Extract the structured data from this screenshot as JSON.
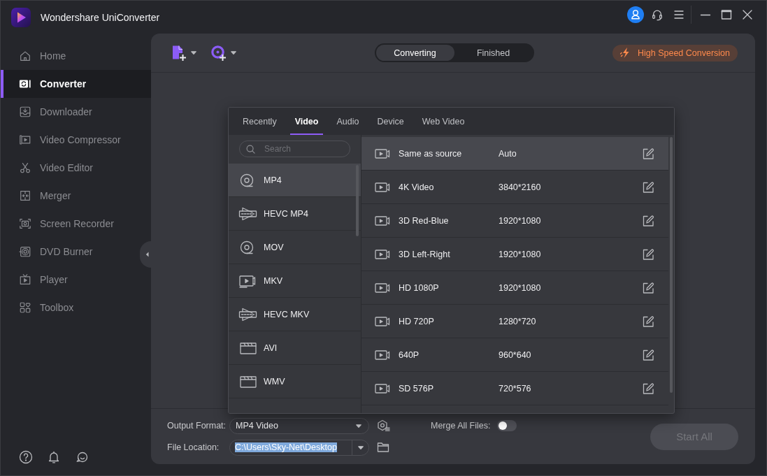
{
  "window": {
    "title": "Wondershare UniConverter"
  },
  "sidebar": {
    "items": [
      {
        "label": "Home",
        "selected": false
      },
      {
        "label": "Converter",
        "selected": true
      },
      {
        "label": "Downloader",
        "selected": false
      },
      {
        "label": "Video Compressor",
        "selected": false
      },
      {
        "label": "Video Editor",
        "selected": false
      },
      {
        "label": "Merger",
        "selected": false
      },
      {
        "label": "Screen Recorder",
        "selected": false
      },
      {
        "label": "DVD Burner",
        "selected": false
      },
      {
        "label": "Player",
        "selected": false
      },
      {
        "label": "Toolbox",
        "selected": false
      }
    ]
  },
  "toolbar": {
    "tabs": [
      {
        "label": "Converting",
        "selected": true
      },
      {
        "label": "Finished",
        "selected": false
      }
    ],
    "high_speed_button": "High Speed Conversion"
  },
  "format_popup": {
    "tabs": [
      {
        "label": "Recently",
        "selected": false
      },
      {
        "label": "Video",
        "selected": true
      },
      {
        "label": "Audio",
        "selected": false
      },
      {
        "label": "Device",
        "selected": false
      },
      {
        "label": "Web Video",
        "selected": false
      }
    ],
    "search": {
      "placeholder": "Search"
    },
    "formats": [
      {
        "label": "MP4",
        "selected": true
      },
      {
        "label": "HEVC MP4",
        "selected": false
      },
      {
        "label": "MOV",
        "selected": false
      },
      {
        "label": "MKV",
        "selected": false
      },
      {
        "label": "HEVC MKV",
        "selected": false
      },
      {
        "label": "AVI",
        "selected": false
      },
      {
        "label": "WMV",
        "selected": false
      }
    ],
    "presets": [
      {
        "name": "Same as source",
        "resolution": "Auto",
        "selected": true
      },
      {
        "name": "4K Video",
        "resolution": "3840*2160",
        "selected": false
      },
      {
        "name": "3D Red-Blue",
        "resolution": "1920*1080",
        "selected": false
      },
      {
        "name": "3D Left-Right",
        "resolution": "1920*1080",
        "selected": false
      },
      {
        "name": "HD 1080P",
        "resolution": "1920*1080",
        "selected": false
      },
      {
        "name": "HD 720P",
        "resolution": "1280*720",
        "selected": false
      },
      {
        "name": "640P",
        "resolution": "960*640",
        "selected": false
      },
      {
        "name": "SD 576P",
        "resolution": "720*576",
        "selected": false
      }
    ]
  },
  "bottom_bar": {
    "output_format": {
      "label": "Output Format:",
      "value": "MP4 Video"
    },
    "merge_all_files": {
      "label": "Merge All Files:",
      "on": false
    },
    "file_location": {
      "label": "File Location:",
      "value": "C:\\Users\\Sky-Net\\Desktop",
      "text_selected": true
    },
    "start_button": {
      "label": "Start All",
      "disabled": true
    }
  }
}
